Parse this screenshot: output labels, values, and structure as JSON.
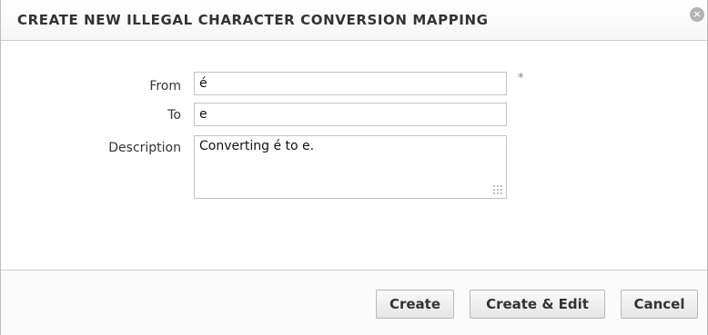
{
  "dialog": {
    "title": "CREATE NEW ILLEGAL CHARACTER CONVERSION MAPPING",
    "close_icon": "close-icon"
  },
  "form": {
    "from_label": "From",
    "from_value": "é",
    "required_marker": "*",
    "to_label": "To",
    "to_value": "e",
    "description_label": "Description",
    "description_value": "Converting é to e."
  },
  "buttons": {
    "create": "Create",
    "create_edit": "Create & Edit",
    "cancel": "Cancel"
  }
}
